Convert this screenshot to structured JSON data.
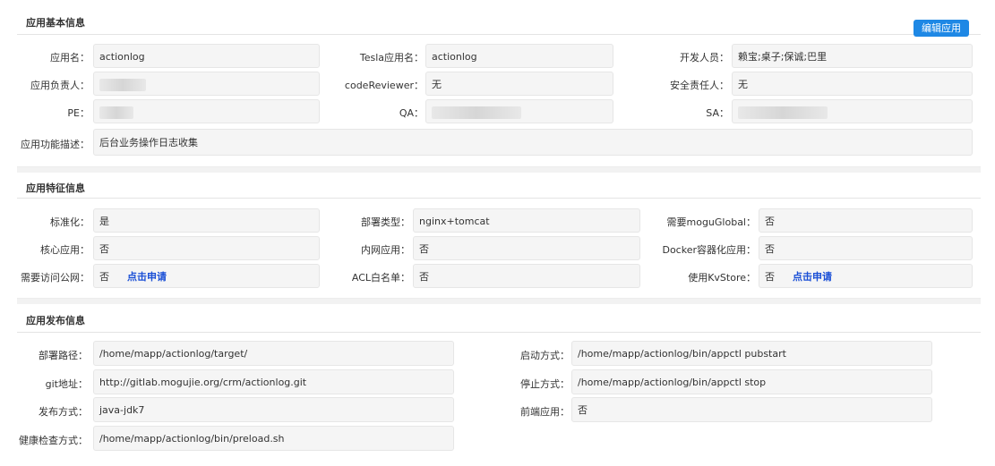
{
  "basic": {
    "title": "应用基本信息",
    "edit_button": "编辑应用",
    "app_name_label": "应用名：",
    "app_name": "actionlog",
    "tesla_name_label": "Tesla应用名：",
    "tesla_name": "actionlog",
    "developers_label": "开发人员：",
    "developers": "赖宝;桌子;保诚;巴里",
    "owner_label": "应用负责人：",
    "code_reviewer_label": "codeReviewer：",
    "code_reviewer": "无",
    "security_label": "安全责任人：",
    "security": "无",
    "pe_label": "PE：",
    "qa_label": "QA：",
    "sa_label": "SA：",
    "desc_label": "应用功能描述：",
    "desc": "后台业务操作日志收集"
  },
  "features": {
    "title": "应用特征信息",
    "standardized_label": "标准化：",
    "standardized": "是",
    "deploy_type_label": "部署类型：",
    "deploy_type": "nginx+tomcat",
    "mogu_label": "需要moguGlobal：",
    "mogu": "否",
    "core_label": "核心应用：",
    "core": "否",
    "intranet_label": "内网应用：",
    "intranet": "否",
    "docker_label": "Docker容器化应用：",
    "docker": "否",
    "public_label": "需要访问公网：",
    "public": "否",
    "public_apply": "点击申请",
    "acl_label": "ACL白名单：",
    "acl": "否",
    "kv_label": "使用KvStore：",
    "kv": "否",
    "kv_apply": "点击申请"
  },
  "release": {
    "title": "应用发布信息",
    "deploy_path_label": "部署路径：",
    "deploy_path": "/home/mapp/actionlog/target/",
    "start_label": "启动方式：",
    "start": "/home/mapp/actionlog/bin/appctl pubstart",
    "git_label": "git地址：",
    "git": "http://gitlab.mogujie.org/crm/actionlog.git",
    "stop_label": "停止方式：",
    "stop": "/home/mapp/actionlog/bin/appctl stop",
    "publish_label": "发布方式：",
    "publish": "java-jdk7",
    "frontend_label": "前端应用：",
    "frontend": "否",
    "health_label": "健康检查方式：",
    "health": "/home/mapp/actionlog/bin/preload.sh"
  }
}
